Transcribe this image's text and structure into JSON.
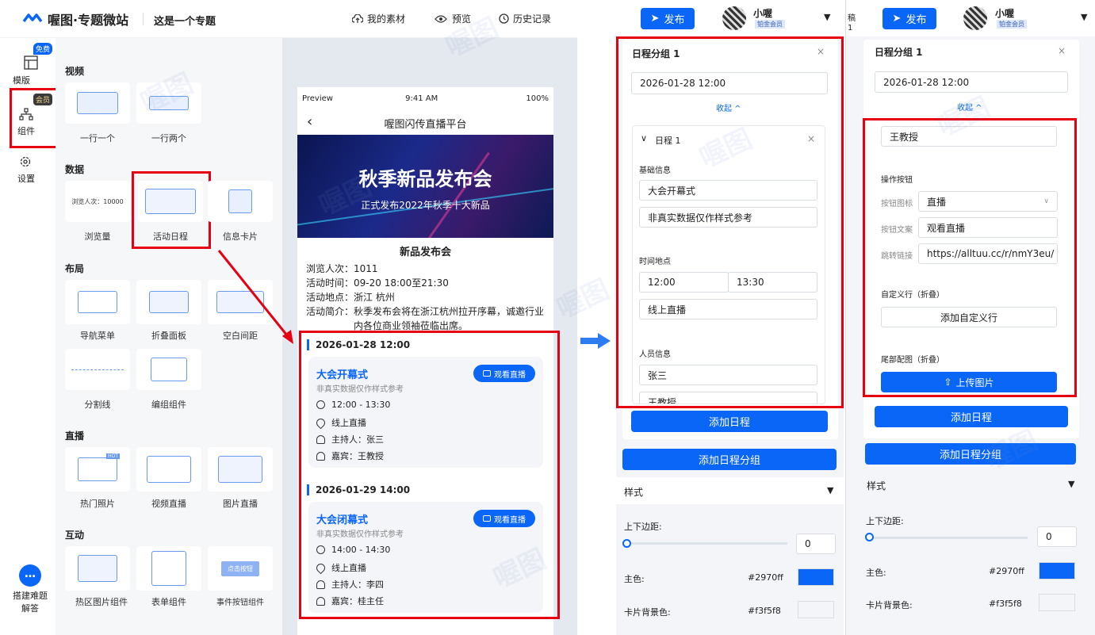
{
  "header": {
    "logo_text": "喔图·专题微站",
    "project_title": "这是一个专题",
    "my_materials": "我的素材",
    "preview": "预览",
    "history": "历史记录"
  },
  "leftnav": {
    "free_badge": "免费",
    "member_badge": "会员",
    "items": [
      {
        "label": "模版"
      },
      {
        "label": "组件"
      },
      {
        "label": "设置"
      }
    ],
    "help": "搭建难题\n解答"
  },
  "palette": {
    "sections": [
      {
        "title": "视频",
        "items": [
          "一行一个",
          "一行两个"
        ]
      },
      {
        "title": "数据",
        "items": [
          "浏览量",
          "活动日程",
          "信息卡片"
        ],
        "pv_tile_text": "浏览人次：10000"
      },
      {
        "title": "布局",
        "items": [
          "导航菜单",
          "折叠面板",
          "空白间距",
          "分割线",
          "编组组件"
        ]
      },
      {
        "title": "直播",
        "items": [
          "热门照片",
          "视频直播",
          "图片直播"
        ],
        "hot_tag": "HOT"
      },
      {
        "title": "互动",
        "items": [
          "热区图片组件",
          "表单组件",
          "事件按钮组件"
        ],
        "click_btn": "点击按钮"
      }
    ]
  },
  "phone": {
    "status_left": "Preview",
    "time": "9:41 AM",
    "battery": "100%",
    "nav_title": "喔图闪传直播平台",
    "banner_title": "秋季新品发布会",
    "banner_sub": "正式发布2022年秋季十大新品",
    "event_title": "新品发布会",
    "info": [
      {
        "k": "浏览人次：",
        "v": "1011"
      },
      {
        "k": "活动时间：",
        "v": "09-20 18:00至21:30"
      },
      {
        "k": "活动地点：",
        "v": "浙江 杭州"
      },
      {
        "k": "活动简介：",
        "v": "秋季发布会将在浙江杭州拉开序幕，诚邀行业\n内各位商业领袖莅临出席。"
      }
    ],
    "groups": [
      {
        "date": "2026-01-28 12:00",
        "title": "大会开幕式",
        "sub": "非真实数据仅作样式参考",
        "time": "12:00 - 13:30",
        "place": "线上直播",
        "host": "主持人：张三",
        "guest": "嘉宾：王教授",
        "btn": "观看直播"
      },
      {
        "date": "2026-01-29 14:00",
        "title": "大会闭幕式",
        "sub": "非真实数据仅作样式参考",
        "time": "14:00 - 14:30",
        "place": "线上直播",
        "host": "主持人：李四",
        "guest": "嘉宾：桂主任",
        "btn": "观看直播"
      }
    ]
  },
  "panel1": {
    "publish": "发布",
    "user": "小喔",
    "level": "铂金会员",
    "group_title": "日程分组 1",
    "date": "2026-01-28 12:00",
    "collapse": "收起",
    "item_title": "日程 1",
    "basic_label": "基础信息",
    "name_val": "大会开幕式",
    "desc_val": "非真实数据仅作样式参考",
    "timeplace_label": "时间地点",
    "start": "12:00",
    "end": "13:30",
    "place": "线上直播",
    "people_label": "人员信息",
    "host": "张三",
    "guest": "王教授",
    "add_item": "添加日程",
    "add_group": "添加日程分组",
    "style_label": "样式",
    "padding_label": "上下边距:",
    "padding_val": "0",
    "primary_label": "主色:",
    "primary_hex": "#2970ff",
    "cardbg_label": "卡片背景色:",
    "cardbg_hex": "#f3f5f8"
  },
  "panel2": {
    "publish": "发布",
    "user": "小喔",
    "level": "铂金会员",
    "group_title": "日程分组 1",
    "date": "2026-01-28 12:00",
    "collapse": "收起",
    "guest": "王教授",
    "action_label": "操作按钮",
    "icon_label": "按钮图标",
    "icon_val": "直播",
    "text_label": "按钮文案",
    "text_val": "观看直播",
    "link_label": "跳转链接",
    "link_val": "https://alltuu.cc/r/nmY3eu/",
    "custom_label": "自定义行（折叠）",
    "custom_btn": "添加自定义行",
    "footer_label": "尾部配图（折叠）",
    "upload_btn": "上传图片",
    "add_item": "添加日程",
    "add_group": "添加日程分组",
    "style_label": "样式",
    "padding_label": "上下边距:",
    "padding_val": "0",
    "primary_label": "主色:",
    "primary_hex": "#2970ff",
    "cardbg_label": "卡片背景色:",
    "cardbg_hex": "#f3f5f8",
    "edge_top": "稿",
    "edge_bottom": "1"
  },
  "colors": {
    "accent": "#0a66f6",
    "highlight": "#e60012",
    "bg": "#f1f3f7"
  },
  "watermark": "喔图"
}
